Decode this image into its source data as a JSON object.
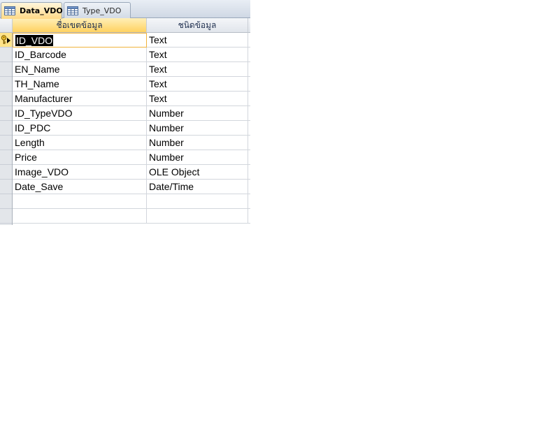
{
  "tabs": [
    {
      "label": "Data_VDO",
      "active": true,
      "icon": "table-icon"
    },
    {
      "label": "Type_VDO",
      "active": false,
      "icon": "table-icon"
    }
  ],
  "columns": {
    "selector": "",
    "field_name": "ชื่อเขตข้อมูล",
    "data_type": "ชนิดข้อมูล"
  },
  "fields": [
    {
      "name": "ID_VDO",
      "type": "Text",
      "primary_key": true,
      "current": true
    },
    {
      "name": "ID_Barcode",
      "type": "Text"
    },
    {
      "name": "EN_Name",
      "type": "Text"
    },
    {
      "name": "TH_Name",
      "type": "Text"
    },
    {
      "name": "Manufacturer",
      "type": "Text"
    },
    {
      "name": "ID_TypeVDO",
      "type": "Number"
    },
    {
      "name": "ID_PDC",
      "type": "Number"
    },
    {
      "name": "Length",
      "type": "Number"
    },
    {
      "name": "Price",
      "type": "Number"
    },
    {
      "name": "Image_VDO",
      "type": "OLE Object"
    },
    {
      "name": "Date_Save",
      "type": "Date/Time"
    },
    {
      "name": "",
      "type": ""
    },
    {
      "name": "",
      "type": ""
    }
  ],
  "colors": {
    "active_tab": "#ffd987",
    "selected_header": "#ffd260",
    "current_row_selector": "#ffe48a"
  }
}
